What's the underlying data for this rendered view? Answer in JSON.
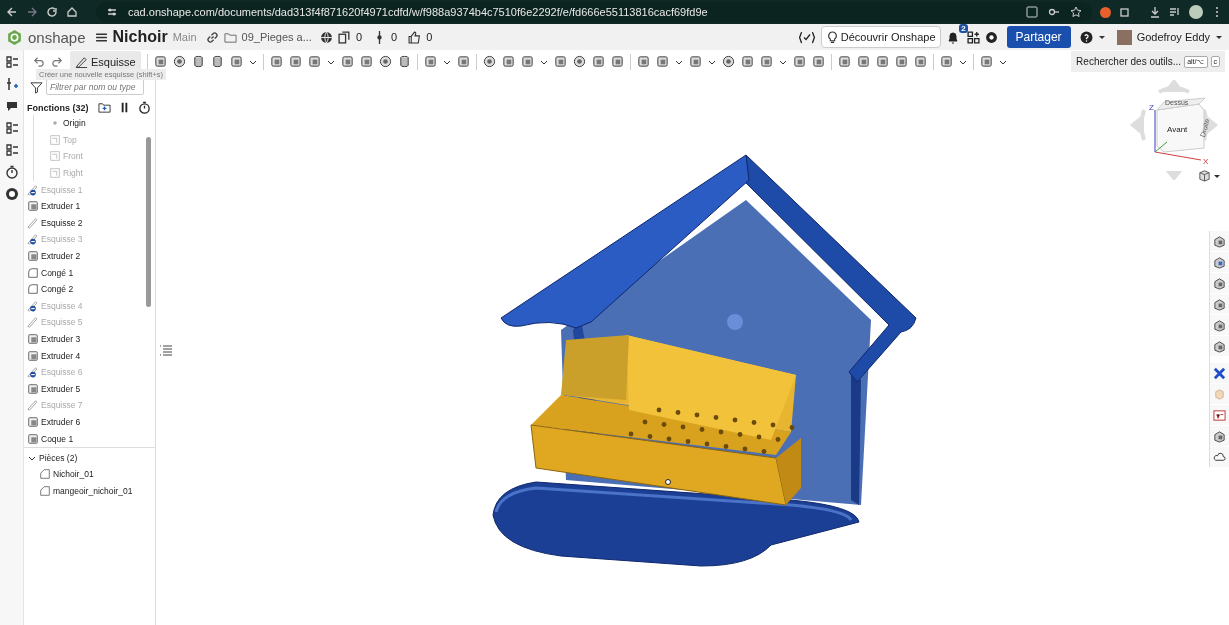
{
  "browser": {
    "url": "cad.onshape.com/documents/dad313f4f871620f4971cdfd/w/f988a9374b4c7510f6e2292f/e/fd666e55113816cacf69fd9e"
  },
  "header": {
    "app_name": "onshape",
    "document": "Nichoir",
    "branch": "Main",
    "folder": "09_Pieges a...",
    "counts": [
      "0",
      "0",
      "0"
    ],
    "discover_button": "Découvrir Onshape",
    "notifications": "2",
    "share_button": "Partager",
    "user": "Godefroy Eddy"
  },
  "toolbar": {
    "sketch_button": "Esquisse",
    "search_placeholder": "Rechercher des outils...",
    "shortcut_keys": [
      "alt/⌥",
      "c"
    ]
  },
  "tooltip": "Créer une nouvelle esquisse (shift+s)",
  "feature_panel": {
    "filter_placeholder": "Filtrer par nom ou type",
    "title": "Fonctions (32)",
    "features": [
      {
        "label": "Origin",
        "kind": "origin",
        "greyed": false,
        "flagged": false
      },
      {
        "label": "Top",
        "kind": "plane",
        "greyed": true,
        "flagged": false
      },
      {
        "label": "Front",
        "kind": "plane",
        "greyed": true,
        "flagged": false
      },
      {
        "label": "Right",
        "kind": "plane",
        "greyed": true,
        "flagged": false
      },
      {
        "label": "Esquisse 1",
        "kind": "sketch",
        "greyed": true,
        "flagged": true
      },
      {
        "label": "Extruder 1",
        "kind": "extrude",
        "greyed": false,
        "flagged": false
      },
      {
        "label": "Esquisse 2",
        "kind": "sketch",
        "greyed": false,
        "flagged": false
      },
      {
        "label": "Esquisse 3",
        "kind": "sketch",
        "greyed": true,
        "flagged": true
      },
      {
        "label": "Extruder 2",
        "kind": "extrude",
        "greyed": false,
        "flagged": false
      },
      {
        "label": "Congé 1",
        "kind": "fillet",
        "greyed": false,
        "flagged": false
      },
      {
        "label": "Congé 2",
        "kind": "fillet",
        "greyed": false,
        "flagged": false
      },
      {
        "label": "Esquisse 4",
        "kind": "sketch",
        "greyed": true,
        "flagged": true
      },
      {
        "label": "Esquisse 5",
        "kind": "sketch",
        "greyed": true,
        "flagged": false
      },
      {
        "label": "Extruder 3",
        "kind": "extrude",
        "greyed": false,
        "flagged": false
      },
      {
        "label": "Extruder 4",
        "kind": "extrude",
        "greyed": false,
        "flagged": false
      },
      {
        "label": "Esquisse 6",
        "kind": "sketch",
        "greyed": true,
        "flagged": true
      },
      {
        "label": "Extruder 5",
        "kind": "extrude",
        "greyed": false,
        "flagged": false
      },
      {
        "label": "Esquisse 7",
        "kind": "sketch",
        "greyed": true,
        "flagged": false
      },
      {
        "label": "Extruder 6",
        "kind": "extrude",
        "greyed": false,
        "flagged": false
      },
      {
        "label": "Coque 1",
        "kind": "extrude",
        "greyed": false,
        "flagged": false
      }
    ],
    "parts": {
      "title": "Pièces (2)",
      "expanded": true,
      "items": [
        "Nichoir_01",
        "mangeoir_nichoir_01"
      ]
    }
  },
  "view_cube": {
    "face_label": "Avant",
    "top_label": "Dessus",
    "side_label": "Droite",
    "axes": [
      "Z",
      "X"
    ]
  }
}
